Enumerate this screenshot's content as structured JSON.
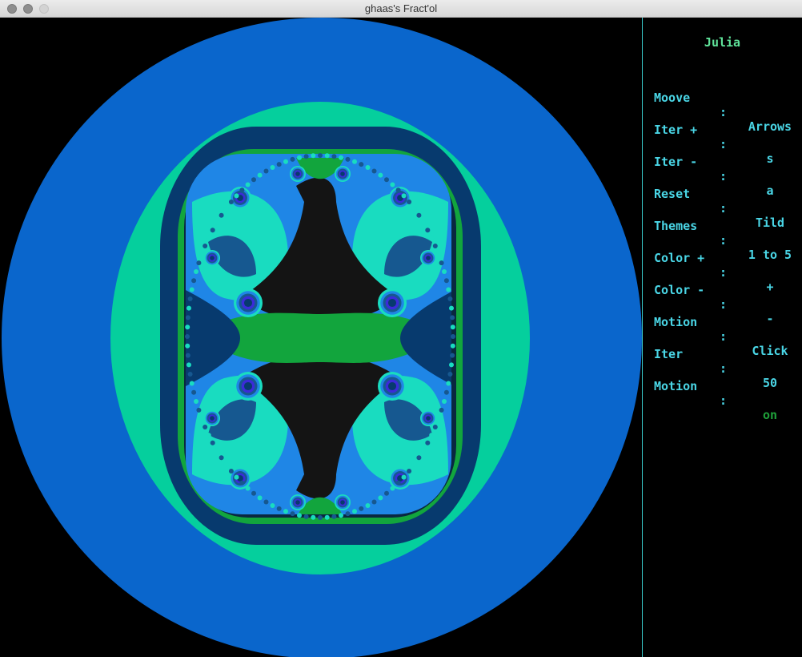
{
  "window": {
    "title": "ghaas's Fract'ol"
  },
  "panel": {
    "title": "Julia",
    "rows": [
      {
        "key": "Moove",
        "sep": ":",
        "value": "Arrows"
      },
      {
        "key": "Iter +",
        "sep": ":",
        "value": "s"
      },
      {
        "key": "Iter -",
        "sep": ":",
        "value": "a"
      },
      {
        "key": "Reset",
        "sep": ":",
        "value": "Tild"
      },
      {
        "key": "Themes",
        "sep": ":",
        "value": "1 to 5"
      },
      {
        "key": "Color +",
        "sep": ":",
        "value": "+"
      },
      {
        "key": "Color -",
        "sep": ":",
        "value": "-"
      },
      {
        "key": "Motion",
        "sep": ":",
        "value": "Click"
      },
      {
        "key": "Iter",
        "sep": ":",
        "value": "50"
      },
      {
        "key": "Motion",
        "sep": ":",
        "value": "on"
      }
    ]
  },
  "colors": {
    "outer_blue": "#0a66cc",
    "teal": "#05cf9d",
    "navy": "#073a6e",
    "green": "#12a53d",
    "black_core": "#141414",
    "light_blue": "#1f86e6",
    "aqua": "#19dcc0",
    "steel": "#165890",
    "panel_text": "#4ad6e6",
    "panel_title": "#5fe39a",
    "status_on": "#1fa13a"
  }
}
